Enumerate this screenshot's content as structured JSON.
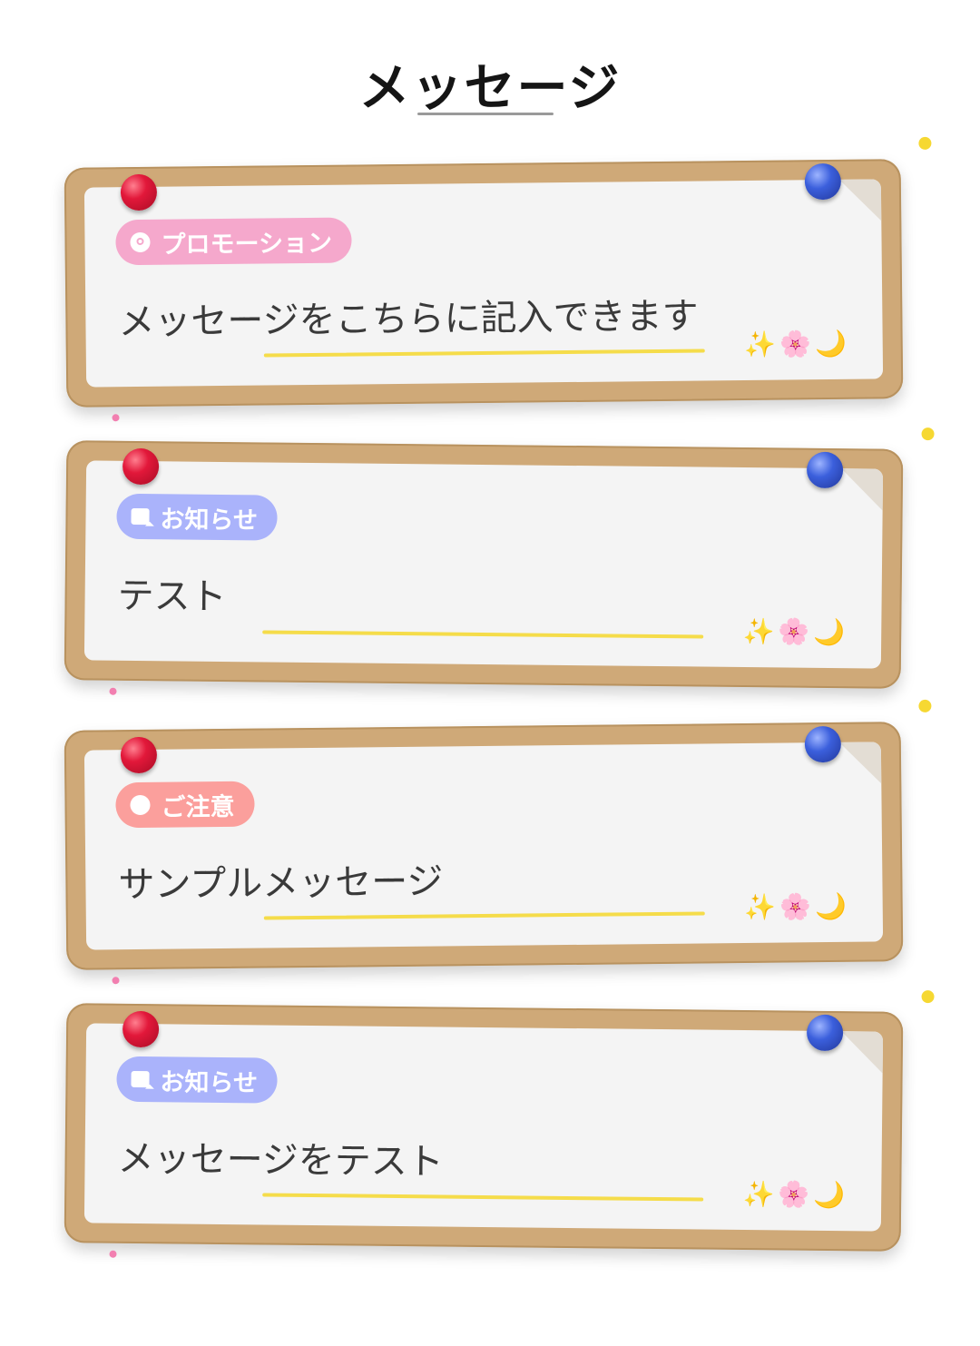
{
  "header": {
    "title": "メッセージ"
  },
  "messages": [
    {
      "badge": "プロモーション",
      "badge_type": "promotion",
      "badge_icon": "promotion-icon",
      "badge_color": "#f5a8cc",
      "text": "メッセージをこちらに記入できます"
    },
    {
      "badge": "お知らせ",
      "badge_type": "notice",
      "badge_icon": "chat-bubble-icon",
      "badge_color": "#aab3fb",
      "text": "テスト"
    },
    {
      "badge": "ご注意",
      "badge_type": "caution",
      "badge_icon": "dot-icon",
      "badge_color": "#fb9f9c",
      "text": "サンプルメッセージ"
    },
    {
      "badge": "お知らせ",
      "badge_type": "notice",
      "badge_icon": "chat-bubble-icon",
      "badge_color": "#aab3fb",
      "text": "メッセージをテスト"
    }
  ],
  "decorations": {
    "sparkle": "✨",
    "blossom": "🌸",
    "moon": "🌙"
  },
  "colors": {
    "frame": "#cfa978",
    "paper": "#f4f4f4",
    "pin_red": "#e2183a",
    "pin_blue": "#3b5fdc",
    "underline": "#f5dc4a"
  }
}
